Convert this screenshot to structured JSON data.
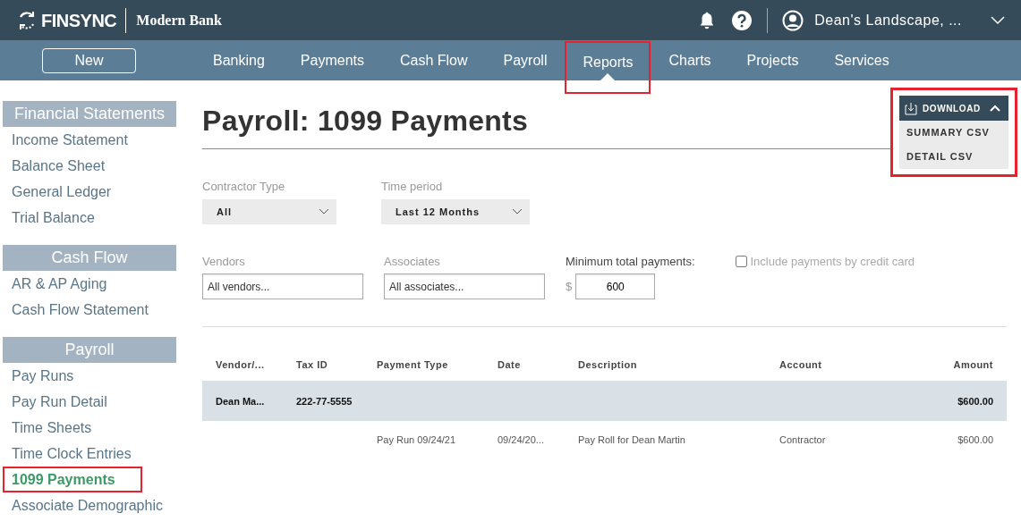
{
  "brand": {
    "name": "FINSYNC",
    "bank": "Modern Bank"
  },
  "account": {
    "name": "Dean's Landscape, ..."
  },
  "new_button": "New",
  "nav": [
    {
      "label": "Banking",
      "selected": false,
      "highlighted": false
    },
    {
      "label": "Payments",
      "selected": false,
      "highlighted": false
    },
    {
      "label": "Cash Flow",
      "selected": false,
      "highlighted": false
    },
    {
      "label": "Payroll",
      "selected": false,
      "highlighted": false
    },
    {
      "label": "Reports",
      "selected": true,
      "highlighted": true
    },
    {
      "label": "Charts",
      "selected": false,
      "highlighted": false
    },
    {
      "label": "Projects",
      "selected": false,
      "highlighted": false
    },
    {
      "label": "Services",
      "selected": false,
      "highlighted": false
    }
  ],
  "sidebar": [
    {
      "title": "Financial Statements",
      "items": [
        {
          "label": "Income Statement",
          "selected": false,
          "highlighted": false
        },
        {
          "label": "Balance Sheet",
          "selected": false,
          "highlighted": false
        },
        {
          "label": "General Ledger",
          "selected": false,
          "highlighted": false
        },
        {
          "label": "Trial Balance",
          "selected": false,
          "highlighted": false
        }
      ]
    },
    {
      "title": "Cash Flow",
      "items": [
        {
          "label": "AR & AP Aging",
          "selected": false,
          "highlighted": false
        },
        {
          "label": "Cash Flow Statement",
          "selected": false,
          "highlighted": false
        }
      ]
    },
    {
      "title": "Payroll",
      "items": [
        {
          "label": "Pay Runs",
          "selected": false,
          "highlighted": false
        },
        {
          "label": "Pay Run Detail",
          "selected": false,
          "highlighted": false
        },
        {
          "label": "Time Sheets",
          "selected": false,
          "highlighted": false
        },
        {
          "label": "Time Clock Entries",
          "selected": false,
          "highlighted": false
        },
        {
          "label": "1099 Payments",
          "selected": true,
          "highlighted": true
        },
        {
          "label": "Associate Demographic",
          "selected": false,
          "highlighted": false
        }
      ]
    }
  ],
  "page_title": "Payroll: 1099 Payments",
  "download": {
    "label": "DOWNLOAD",
    "expanded": true,
    "highlighted": true,
    "options": [
      "SUMMARY CSV",
      "DETAIL CSV"
    ]
  },
  "filters": {
    "contractor_type": {
      "label": "Contractor Type",
      "value": "All"
    },
    "time_period": {
      "label": "Time period",
      "value": "Last 12 Months"
    },
    "vendors": {
      "label": "Vendors",
      "placeholder": "All vendors..."
    },
    "associates": {
      "label": "Associates",
      "placeholder": "All associates..."
    },
    "minimum": {
      "label": "Minimum total payments:",
      "currency": "$",
      "value": "600"
    },
    "credit_card": {
      "label": "Include payments by credit card",
      "checked": false
    }
  },
  "table": {
    "columns": [
      "Vendor/...",
      "Tax ID",
      "Payment Type",
      "Date",
      "Description",
      "Account",
      "Amount"
    ],
    "rows": [
      {
        "kind": "group",
        "cells": [
          "Dean Ma...",
          "222-77-5555",
          "",
          "",
          "",
          "",
          "$600.00"
        ]
      },
      {
        "kind": "detail",
        "cells": [
          "",
          "",
          "Pay Run 09/24/21",
          "09/24/20...",
          "Pay Roll for Dean Martin",
          "Contractor",
          "$600.00"
        ]
      }
    ]
  }
}
